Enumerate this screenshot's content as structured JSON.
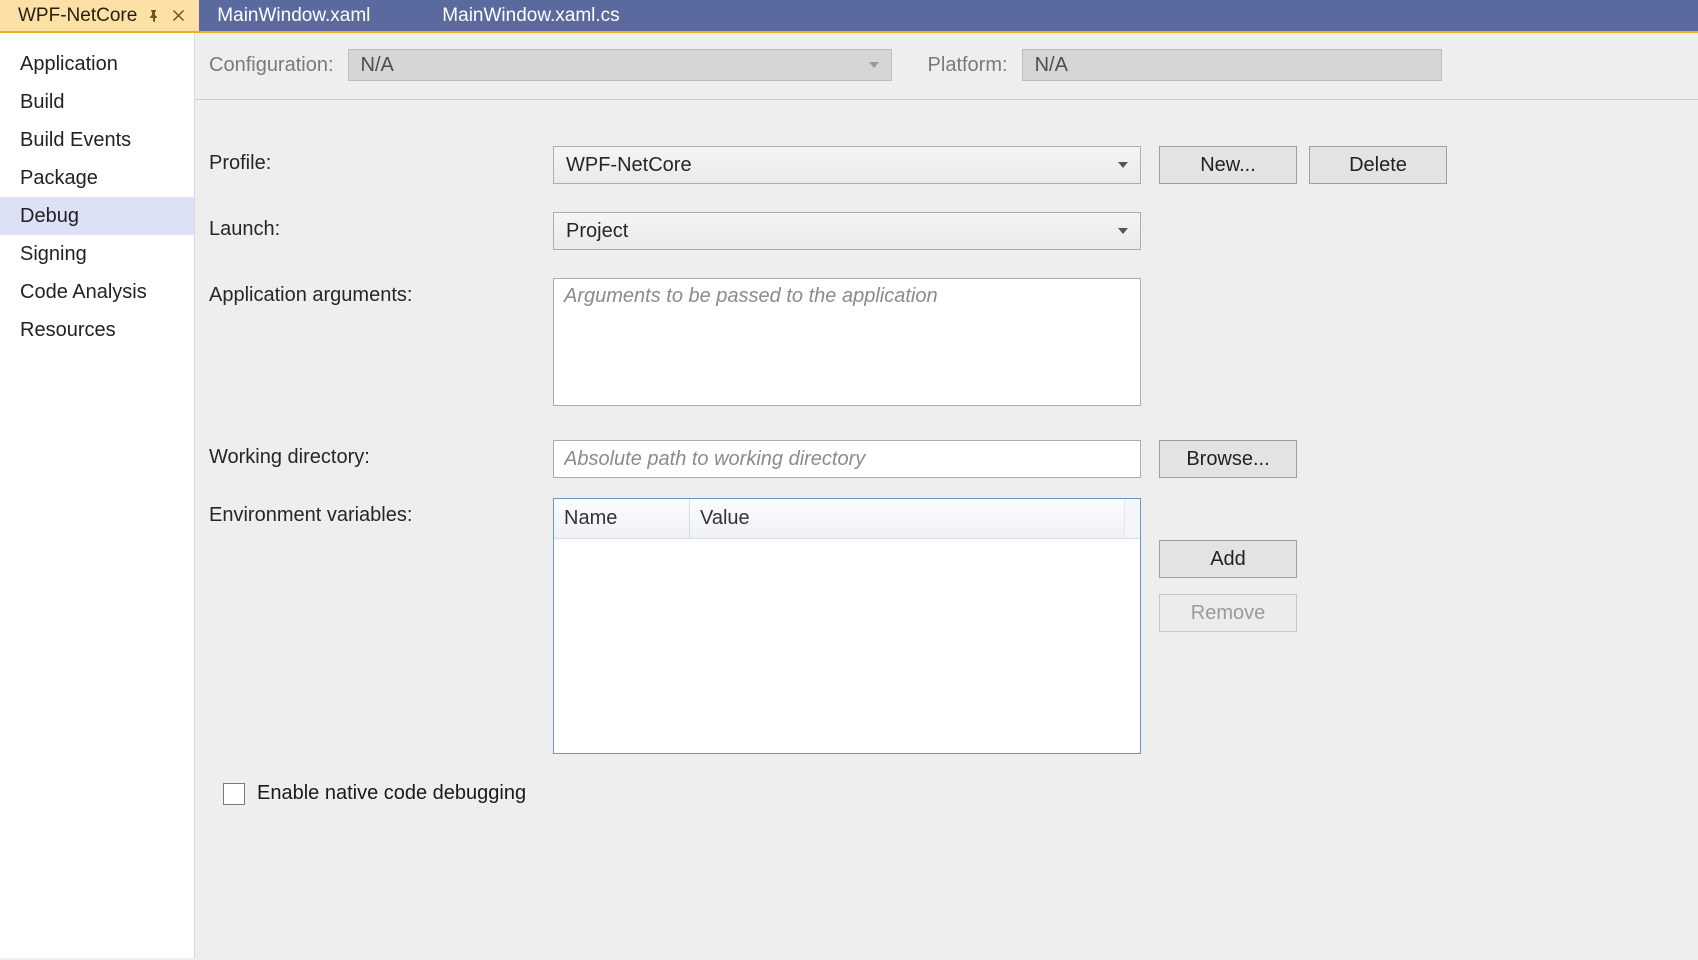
{
  "tabs": {
    "active": "WPF-NetCore",
    "t1": "MainWindow.xaml",
    "t2": "MainWindow.xaml.cs"
  },
  "sidebar": {
    "items": [
      "Application",
      "Build",
      "Build Events",
      "Package",
      "Debug",
      "Signing",
      "Code Analysis",
      "Resources"
    ],
    "selected_index": 4
  },
  "config": {
    "configuration_label": "Configuration:",
    "configuration_value": "N/A",
    "platform_label": "Platform:",
    "platform_value": "N/A"
  },
  "form": {
    "profile_label": "Profile:",
    "profile_value": "WPF-NetCore",
    "launch_label": "Launch:",
    "launch_value": "Project",
    "appargs_label": "Application arguments:",
    "appargs_placeholder": "Arguments to be passed to the application",
    "workdir_label": "Working directory:",
    "workdir_placeholder": "Absolute path to working directory",
    "envvars_label": "Environment variables:",
    "envcol_name": "Name",
    "envcol_value": "Value",
    "native_label": "Enable native code debugging"
  },
  "buttons": {
    "new": "New...",
    "delete": "Delete",
    "browse": "Browse...",
    "add": "Add",
    "remove": "Remove"
  }
}
